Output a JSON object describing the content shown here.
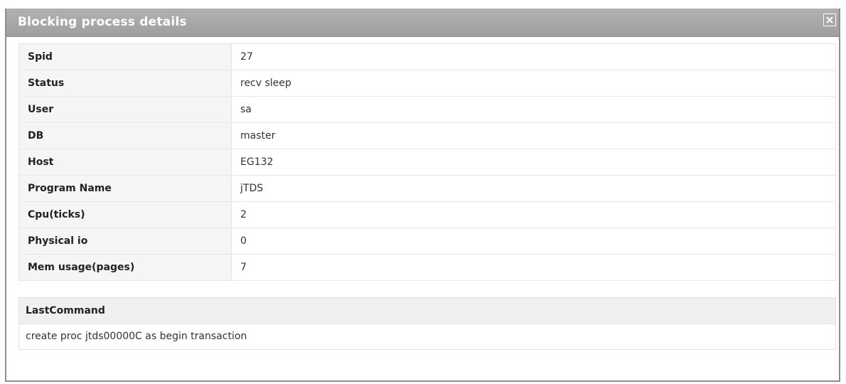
{
  "dialog": {
    "title": "Blocking process details",
    "close_icon": "close-icon"
  },
  "details": [
    {
      "label": "Spid",
      "value": "27"
    },
    {
      "label": "Status",
      "value": "recv sleep"
    },
    {
      "label": "User",
      "value": "sa"
    },
    {
      "label": "DB",
      "value": "master"
    },
    {
      "label": "Host",
      "value": "EG132"
    },
    {
      "label": "Program Name",
      "value": "jTDS"
    },
    {
      "label": "Cpu(ticks)",
      "value": "2"
    },
    {
      "label": "Physical io",
      "value": "0"
    },
    {
      "label": "Mem usage(pages)",
      "value": "7"
    }
  ],
  "last_command": {
    "header": "LastCommand",
    "text": "create proc jtds00000C as begin transaction"
  }
}
